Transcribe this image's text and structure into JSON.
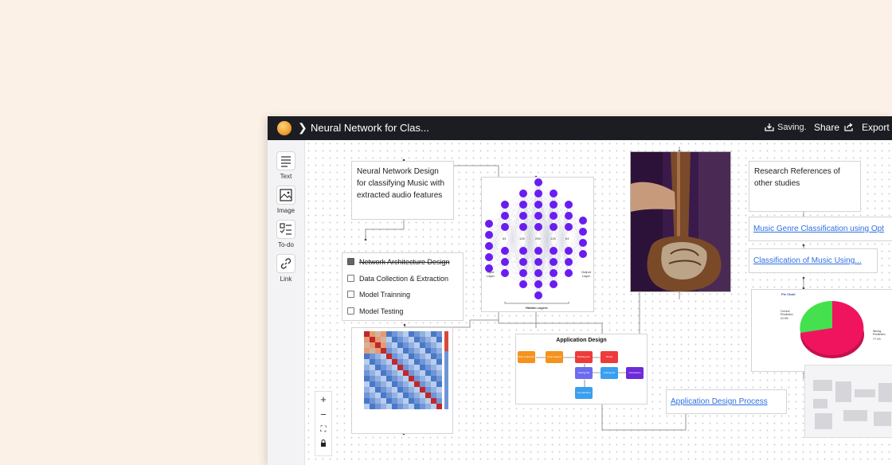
{
  "header": {
    "title": "Neural Network for Clas...",
    "saving_label": "Saving.",
    "share_label": "Share",
    "export_label": "Export"
  },
  "sidebar": {
    "tools": [
      {
        "label": "Text",
        "icon": "text-icon"
      },
      {
        "label": "Image",
        "icon": "image-icon"
      },
      {
        "label": "To-do",
        "icon": "todo-icon"
      },
      {
        "label": "Link",
        "icon": "link-icon"
      }
    ]
  },
  "canvas": {
    "note_main": "Neural Network Design for classifying Music with extracted audio features",
    "todo": [
      {
        "label": "Network Architecture Design",
        "checked": true
      },
      {
        "label": "Data Collection & Extraction",
        "checked": false
      },
      {
        "label": "Model Trainning",
        "checked": false
      },
      {
        "label": "Model Testing",
        "checked": false
      }
    ],
    "research_note": "Research References of other studies",
    "link_1": "Music Genre Classification using Opt",
    "link_2": "Classification of Music Using...",
    "link_app": "Application Design Process",
    "nn_labels": {
      "hidden_layers": "Hidden Layers",
      "input_layer": "Input Layer",
      "output_layer": "Output Layer",
      "n1": "64",
      "n2": "128",
      "n3": "256",
      "n4": "128",
      "n5": "64"
    },
    "app_design": {
      "title": "Application Design",
      "steps": [
        "Data Collection",
        "Data Analysis",
        "Building the Model",
        "Model Architecture Design",
        "Testing the Model",
        "Testing the Results",
        "Conclusion",
        "Comparative Study"
      ]
    },
    "pie": {
      "title": "Pie Chart",
      "correct_label": "Correct Prediction",
      "correct_pct": "22.9%",
      "wrong_label": "Wrong Prediction",
      "wrong_pct": "77.1%"
    }
  },
  "zoom_controls": {
    "zoom_in": "+",
    "zoom_out": "−",
    "fit": "⛶",
    "lock": "🔒"
  },
  "colors": {
    "topbar": "#1c1d22",
    "node_purple": "#6a1df0",
    "link_blue": "#2e6fe0",
    "pie_green": "#44e04e",
    "pie_pink": "#f0145f",
    "orange": "#f5921e",
    "red": "#ee3a3a",
    "blue": "#3b9ff0",
    "violet": "#6c2bd9"
  }
}
